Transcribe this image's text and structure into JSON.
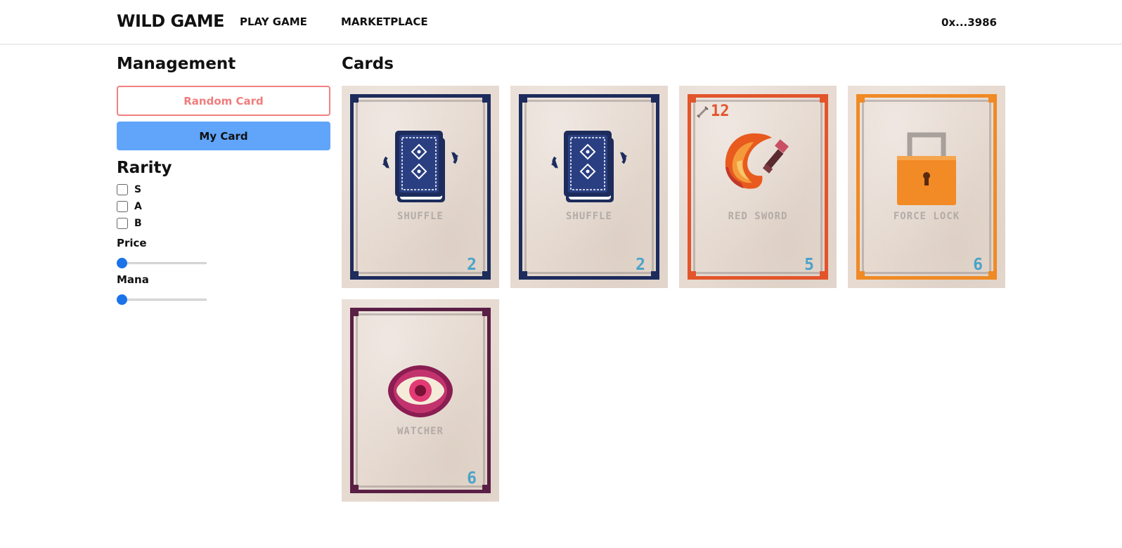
{
  "header": {
    "brand": "WILD GAME",
    "nav": [
      "PLAY GAME",
      "MARKETPLACE"
    ],
    "wallet": "0x...3986"
  },
  "sidebar": {
    "title": "Management",
    "random_button": "Random Card",
    "mycard_button": "My Card",
    "rarity_title": "Rarity",
    "rarity_options": [
      "S",
      "A",
      "B"
    ],
    "price_label": "Price",
    "mana_label": "Mana"
  },
  "main": {
    "title": "Cards",
    "cards": [
      {
        "name": "SHUFFLE",
        "cost": "2",
        "frame_color": "#1d2c5c",
        "icon": "shuffle-deck-icon"
      },
      {
        "name": "SHUFFLE",
        "cost": "2",
        "frame_color": "#1d2c5c",
        "icon": "shuffle-deck-icon"
      },
      {
        "name": "RED SWORD",
        "cost": "5",
        "attack": "12",
        "frame_color": "#e2552b",
        "icon": "red-sword-icon"
      },
      {
        "name": "FORCE LOCK",
        "cost": "6",
        "frame_color": "#f08a24",
        "icon": "padlock-icon"
      },
      {
        "name": "WATCHER",
        "cost": "6",
        "frame_color": "#5a1f45",
        "icon": "eye-icon"
      }
    ]
  },
  "colors": {
    "accent_blue": "#60a5fa",
    "random_red": "#ef7d7d",
    "cost_blue": "#4aa3c9"
  }
}
